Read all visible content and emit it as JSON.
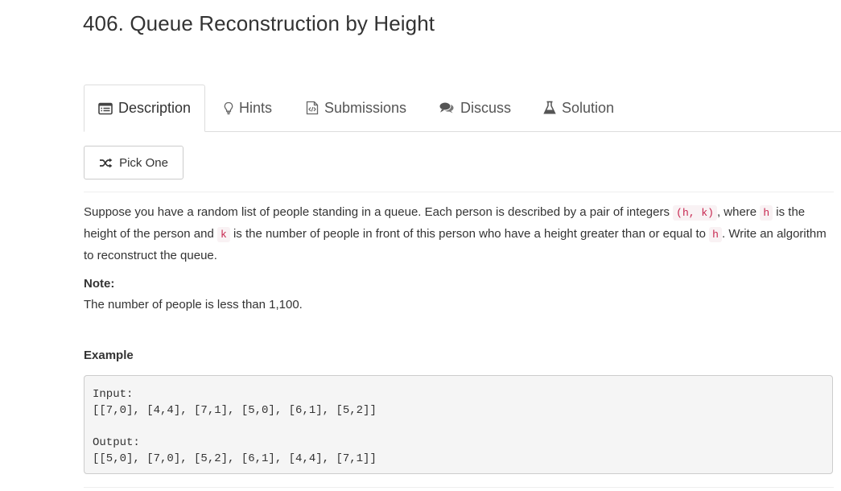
{
  "problem": {
    "title": "406. Queue Reconstruction by Height"
  },
  "tabs": [
    {
      "label": "Description",
      "icon": "list-icon",
      "active": true
    },
    {
      "label": "Hints",
      "icon": "lightbulb-icon",
      "active": false
    },
    {
      "label": "Submissions",
      "icon": "code-file-icon",
      "active": false
    },
    {
      "label": "Discuss",
      "icon": "comments-icon",
      "active": false
    },
    {
      "label": "Solution",
      "icon": "flask-icon",
      "active": false
    }
  ],
  "pick_one": {
    "label": "Pick One",
    "icon": "shuffle-icon"
  },
  "description": {
    "p1": "Suppose you have a random list of people standing in a queue. Each person is described by a pair of integers ",
    "code1": "(h, k)",
    "p2": ", where ",
    "code2": "h",
    "p3": " is the height of the person and ",
    "code3": "k",
    "p4": " is the number of people in front of this person who have a height greater than or equal to ",
    "code4": "h",
    "p5": ". Write an algorithm to reconstruct the queue."
  },
  "note": {
    "label": "Note:",
    "text": "The number of people is less than 1,100."
  },
  "example": {
    "label": "Example",
    "input_label": "Input:",
    "input_value": "[[7,0], [4,4], [7,1], [5,0], [6,1], [5,2]]",
    "output_label": "Output:",
    "output_value": "[[5,0], [7,0], [5,2], [6,1], [4,4], [7,1]]"
  },
  "colors": {
    "inline_code_text": "#c7254e",
    "inline_code_bg": "#f9f2f4",
    "pre_bg": "#f5f5f5",
    "border": "#dddddd"
  }
}
